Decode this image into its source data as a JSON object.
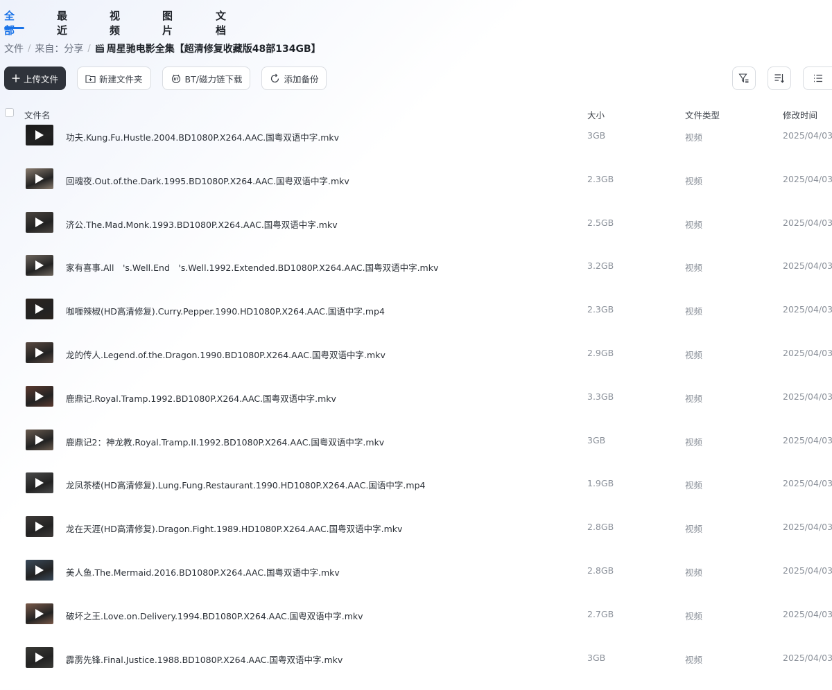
{
  "tabs": [
    {
      "label": "全部",
      "active": true
    },
    {
      "label": "最近"
    },
    {
      "label": "视频"
    },
    {
      "label": "图片"
    },
    {
      "label": "文档"
    }
  ],
  "breadcrumb": {
    "root": "文件",
    "from": "来自：分享",
    "current": "周星驰电影全集【超清修复收藏版48部134GB】"
  },
  "toolbar": {
    "upload": "上传文件",
    "new_folder": "新建文件夹",
    "bt_download": "BT/磁力链下载",
    "add_backup": "添加备份",
    "icons": [
      "filter-icon",
      "sort-icon",
      "list-view-icon"
    ]
  },
  "table": {
    "headers": {
      "name": "文件名",
      "size": "大小",
      "type": "文件类型",
      "modified": "修改时间"
    },
    "rows": [
      {
        "name": "功夫.Kung.Fu.Hustle.2004.BD1080P.X264.AAC.国粤双语中字.mkv",
        "size": "3GB",
        "type": "视频",
        "modified": "2025/04/03",
        "thumb": "#1a1a1a"
      },
      {
        "name": "回魂夜.Out.of.the.Dark.1995.BD1080P.X264.AAC.国粤双语中字.mkv",
        "size": "2.3GB",
        "type": "视频",
        "modified": "2025/04/03",
        "thumb": "#8a7d70"
      },
      {
        "name": "济公.The.Mad.Monk.1993.BD1080P.X264.AAC.国粤双语中字.mkv",
        "size": "2.5GB",
        "type": "视频",
        "modified": "2025/04/03",
        "thumb": "#4a4540"
      },
      {
        "name": "家有喜事.All　's.Well.End　's.Well.1992.Extended.BD1080P.X264.AAC.国粤双语中字.mkv",
        "size": "3.2GB",
        "type": "视频",
        "modified": "2025/04/03",
        "thumb": "#6e665e"
      },
      {
        "name": "咖喱辣椒(HD高清修复).Curry.Pepper.1990.HD1080P.X264.AAC.国语中字.mp4",
        "size": "2.3GB",
        "type": "视频",
        "modified": "2025/04/03",
        "thumb": "#2b2420"
      },
      {
        "name": "龙的传人.Legend.of.the.Dragon.1990.BD1080P.X264.AAC.国粤双语中字.mkv",
        "size": "2.9GB",
        "type": "视频",
        "modified": "2025/04/03",
        "thumb": "#5a4a42"
      },
      {
        "name": "鹿鼎记.Royal.Tramp.1992.BD1080P.X264.AAC.国粤双语中字.mkv",
        "size": "3.3GB",
        "type": "视频",
        "modified": "2025/04/03",
        "thumb": "#5c3a30"
      },
      {
        "name": "鹿鼎记2：神龙教.Royal.Tramp.II.1992.BD1080P.X264.AAC.国粤双语中字.mkv",
        "size": "3GB",
        "type": "视频",
        "modified": "2025/04/03",
        "thumb": "#6a5c50"
      },
      {
        "name": "龙凤茶楼(HD高清修复).Lung.Fung.Restaurant.1990.HD1080P.X264.AAC.国语中字.mp4",
        "size": "1.9GB",
        "type": "视频",
        "modified": "2025/04/03",
        "thumb": "#4a4a4a"
      },
      {
        "name": "龙在天涯(HD高清修复).Dragon.Fight.1989.HD1080P.X264.AAC.国粤双语中字.mkv",
        "size": "2.8GB",
        "type": "视频",
        "modified": "2025/04/03",
        "thumb": "#3e3a38"
      },
      {
        "name": "美人鱼.The.Mermaid.2016.BD1080P.X264.AAC.国粤双语中字.mkv",
        "size": "2.8GB",
        "type": "视频",
        "modified": "2025/04/03",
        "thumb": "#3a4a5a"
      },
      {
        "name": "破坏之王.Love.on.Delivery.1994.BD1080P.X264.AAC.国粤双语中字.mkv",
        "size": "2.7GB",
        "type": "视频",
        "modified": "2025/04/03",
        "thumb": "#7a5a4a"
      },
      {
        "name": "霹雳先锋.Final.Justice.1988.BD1080P.X264.AAC.国粤双语中字.mkv",
        "size": "3GB",
        "type": "视频",
        "modified": "2025/04/03",
        "thumb": "#3a3a36"
      }
    ]
  },
  "colors": {
    "accent": "#1a73e8",
    "primary_button": "#2f333b"
  }
}
